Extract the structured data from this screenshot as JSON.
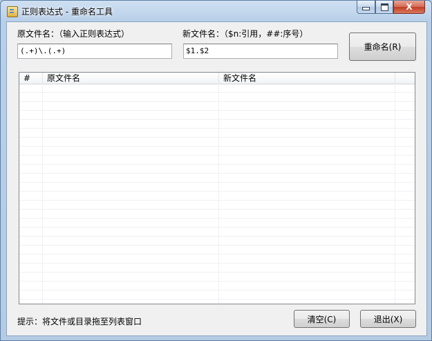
{
  "window": {
    "title": "正则表达式 - 重命名工具",
    "icon": "app-icon"
  },
  "controls": {
    "minimize_icon": "minimize-icon",
    "maximize_icon": "maximize-icon",
    "close_label": "X"
  },
  "source": {
    "label": "原文件名：（输入正则表达式）",
    "value": "(.+)\\.(.+)"
  },
  "target": {
    "label": "新文件名：（$n:引用，##:序号）",
    "value": "$1.$2"
  },
  "buttons": {
    "rename": "重命名(R)",
    "clear": "清空(C)",
    "exit": "退出(X)"
  },
  "table": {
    "columns": [
      "#",
      "原文件名",
      "新文件名",
      ""
    ],
    "rows": []
  },
  "hint": "提示：将文件或目录拖至列表窗口"
}
